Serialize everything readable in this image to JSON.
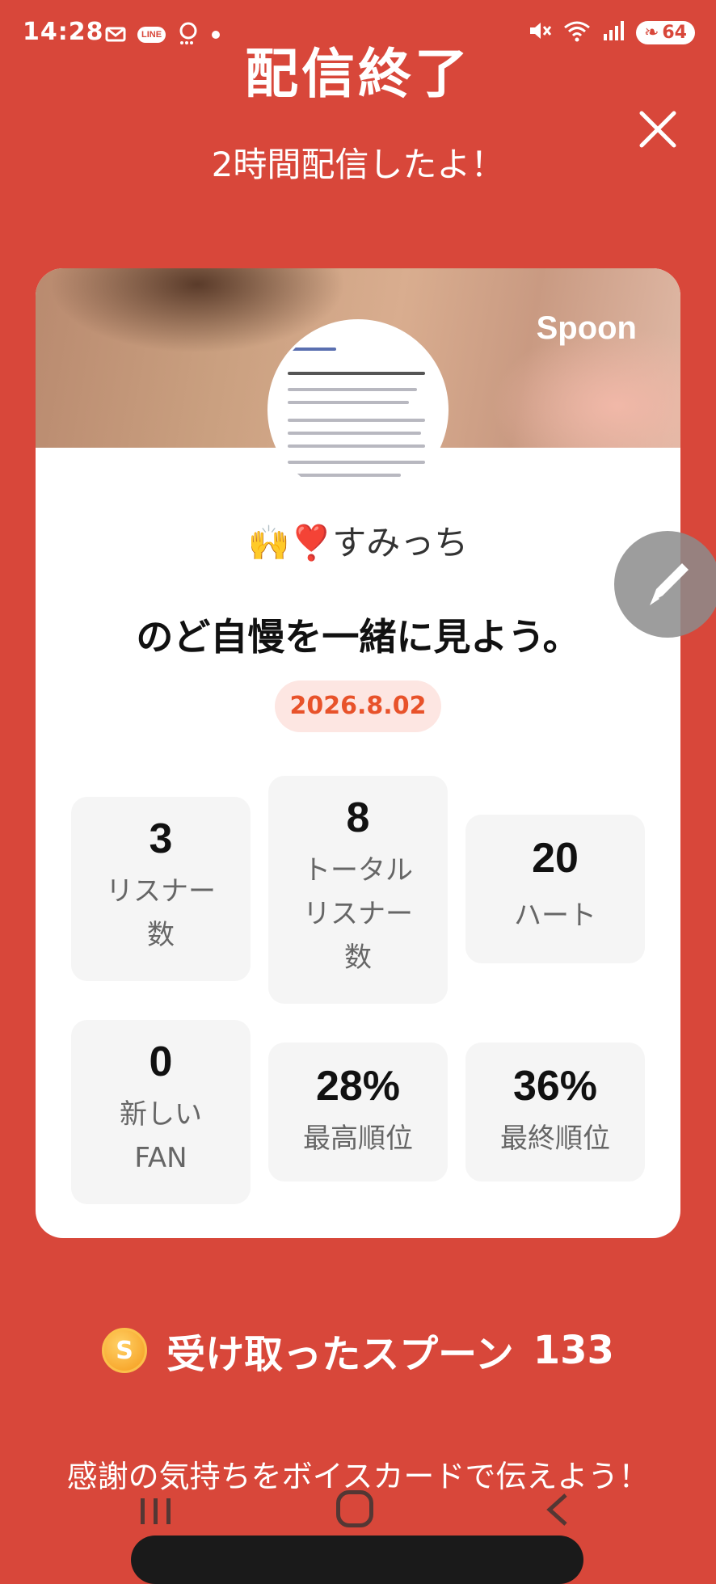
{
  "status_bar": {
    "time": "14:28",
    "battery": "64",
    "notif_line": "LINE"
  },
  "header": {
    "title": "配信終了",
    "subtitle": "2時間配信したよ！"
  },
  "card": {
    "brand": "Spoon",
    "username": "🙌❣️すみっち",
    "heading": "のど自慢を一緒に見よう。",
    "date": "2026.8.02",
    "stats": [
      {
        "value": "3",
        "label": "リスナー\n数"
      },
      {
        "value": "8",
        "label": "トータル\nリスナー\n数"
      },
      {
        "value": "20",
        "label": "ハート"
      },
      {
        "value": "0",
        "label": "新しい\nFAN"
      },
      {
        "value": "28%",
        "label": "最高順位"
      },
      {
        "value": "36%",
        "label": "最終順位"
      }
    ]
  },
  "spoons": {
    "coin_letter": "S",
    "label": "受け取ったスプーン",
    "count": "133"
  },
  "footer": {
    "message": "感謝の気持ちをボイスカードで伝えよう！"
  },
  "colors": {
    "background": "#d8473a",
    "date_text": "#e8522a",
    "date_bg": "#fde6e2"
  }
}
